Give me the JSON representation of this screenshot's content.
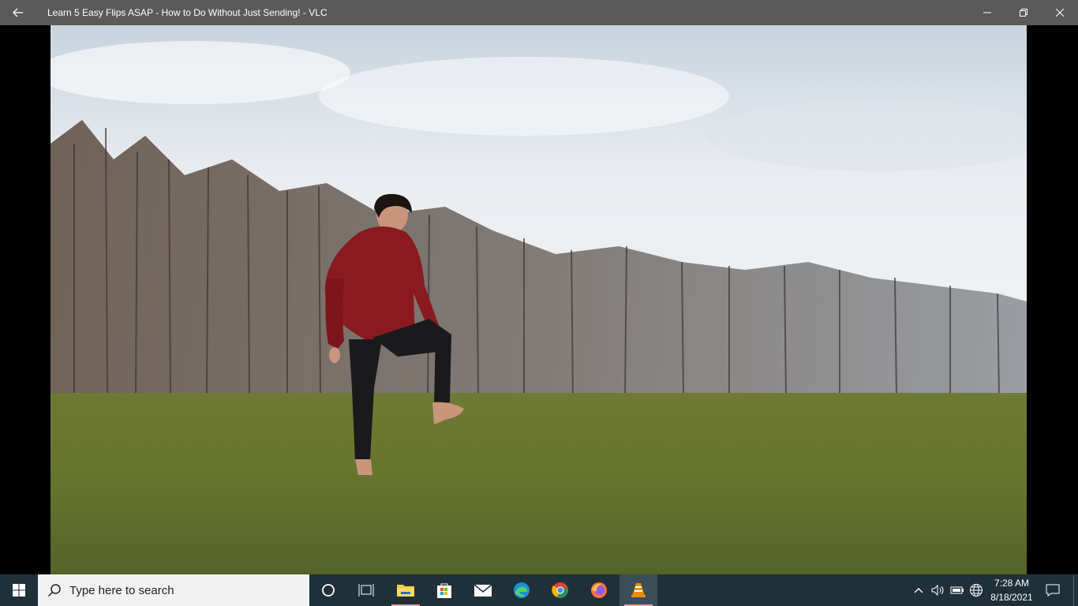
{
  "window": {
    "title": "Learn 5 Easy Flips ASAP - How to Do Without Just Sending! - VLC"
  },
  "taskbar": {
    "search_placeholder": "Type here to search",
    "apps": [
      {
        "name": "cortana",
        "icon": "circle-icon"
      },
      {
        "name": "task-view",
        "icon": "task-view-icon"
      },
      {
        "name": "file-explorer",
        "icon": "folder-icon"
      },
      {
        "name": "microsoft-store",
        "icon": "store-icon"
      },
      {
        "name": "mail",
        "icon": "mail-icon"
      },
      {
        "name": "edge",
        "icon": "edge-icon"
      },
      {
        "name": "chrome",
        "icon": "chrome-icon"
      },
      {
        "name": "firefox",
        "icon": "firefox-icon"
      },
      {
        "name": "vlc",
        "icon": "vlc-icon",
        "active": true
      }
    ],
    "clock": {
      "time": "7:28 AM",
      "date": "8/18/2021"
    }
  },
  "colors": {
    "titlebar_bg": "#5a5a5a",
    "taskbar_bg": "#1f3039",
    "running_indicator": "#e89aa6",
    "vlc_orange": "#f08c00"
  }
}
